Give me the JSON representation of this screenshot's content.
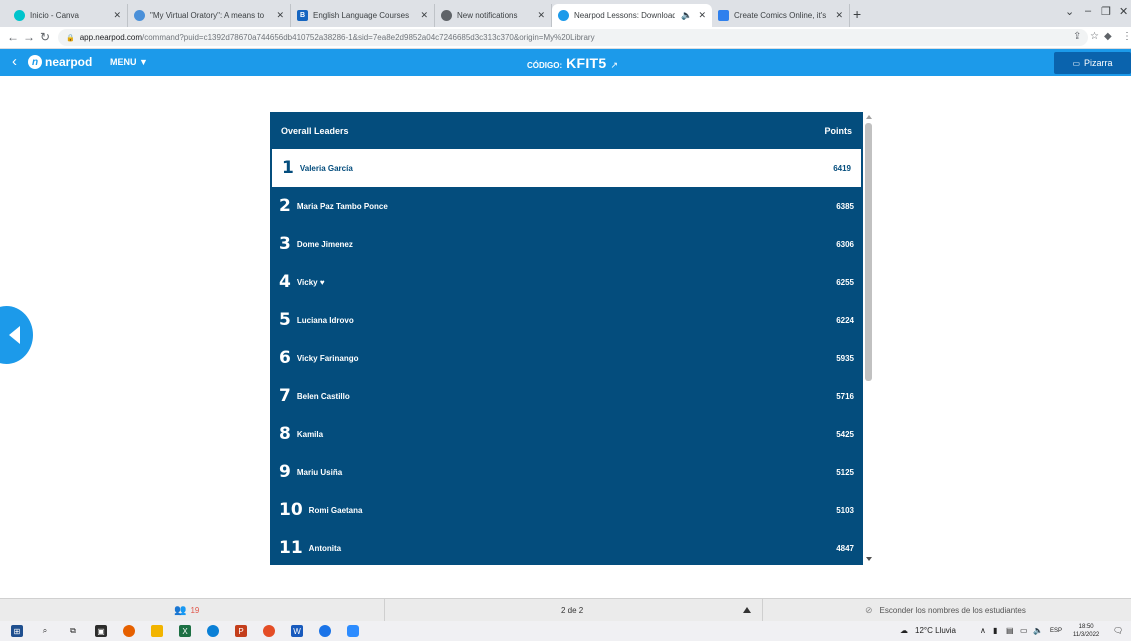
{
  "browser": {
    "tabs": [
      {
        "title": "Inicio - Canva",
        "color": "#00c4cc"
      },
      {
        "title": "\"My Virtual Oratory\": A means to",
        "color": "#4a90d9"
      },
      {
        "title": "English Language Courses",
        "color": "#1565c0",
        "glyph": "B"
      },
      {
        "title": "New notifications",
        "color": "#5f6368"
      },
      {
        "title": "Nearpod Lessons: Download",
        "color": "#1c9aea",
        "active": true
      },
      {
        "title": "Create Comics Online, it's Fun & Ea",
        "color": "#2f80ed"
      }
    ],
    "url_host": "app.nearpod.com",
    "url_rest": "/command?puid=c1392d78670a744656db410752a38286-1&sid=7ea8e2d9852a04c7246685d3c313c370&origin=My%20Library"
  },
  "header": {
    "logo_text": "nearpod",
    "menu_label": "MENU ▼",
    "code_label": "CÓDIGO:",
    "code_value": "KFIT5",
    "pizarra_label": "Pizarra"
  },
  "leaderboard": {
    "title": "Overall Leaders",
    "points_header": "Points",
    "rows": [
      {
        "rank": "1",
        "name": "Valeria García",
        "points": "6419"
      },
      {
        "rank": "2",
        "name": "Maria Paz Tambo Ponce",
        "points": "6385"
      },
      {
        "rank": "3",
        "name": "Dome Jimenez",
        "points": "6306"
      },
      {
        "rank": "4",
        "name": "Vicky ♥",
        "points": "6255"
      },
      {
        "rank": "5",
        "name": "Luciana Idrovo",
        "points": "6224"
      },
      {
        "rank": "6",
        "name": "Vicky Farinango",
        "points": "5935"
      },
      {
        "rank": "7",
        "name": "Belen Castillo",
        "points": "5716"
      },
      {
        "rank": "8",
        "name": "Kamila",
        "points": "5425"
      },
      {
        "rank": "9",
        "name": "Mariu Usiña",
        "points": "5125"
      },
      {
        "rank": "10",
        "name": "Romi Gaetana",
        "points": "5103"
      },
      {
        "rank": "11",
        "name": "Antonita",
        "points": "4847"
      }
    ]
  },
  "footer": {
    "student_count": "19",
    "page_indicator": "2 de 2",
    "hide_names_label": "Esconder los nombres de los estudiantes"
  },
  "taskbar": {
    "weather": "12°C Lluvia",
    "lang": "ESP",
    "time": "18:50",
    "date": "11/3/2022"
  },
  "colors": {
    "brand_blue": "#1c9aea",
    "board_navy": "#044d7d",
    "student_red": "#e1584c"
  }
}
